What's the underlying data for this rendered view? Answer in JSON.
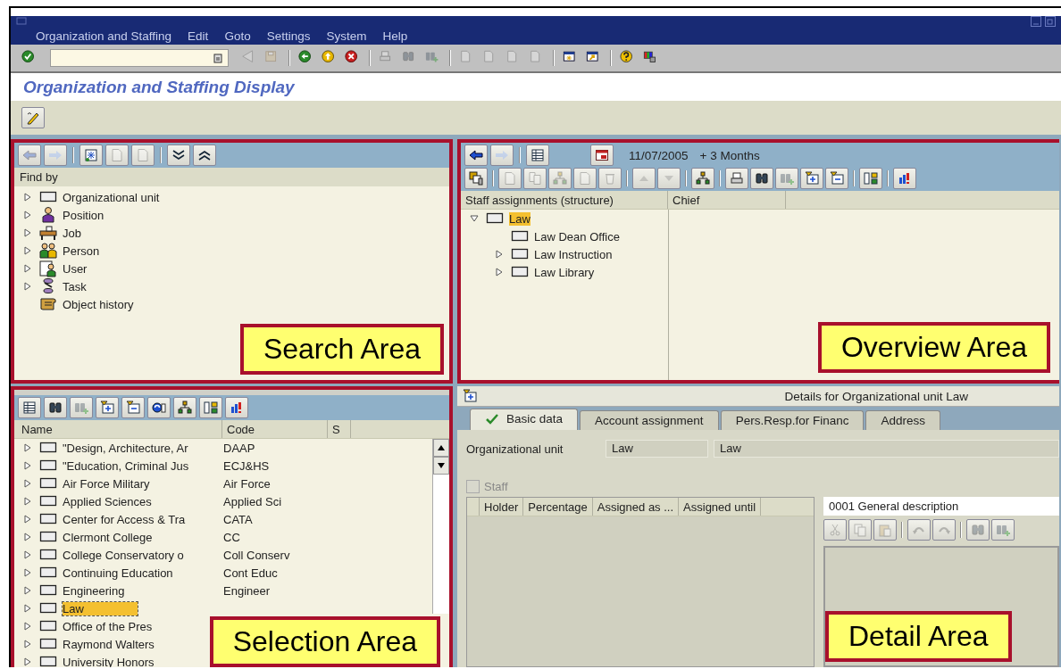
{
  "menu_bar": [
    "Organization and Staffing",
    "Edit",
    "Goto",
    "Settings",
    "System",
    "Help"
  ],
  "toolbar": {
    "buttons": [
      {
        "disabled": false
      },
      {
        "disabled": true
      },
      {
        "disabled": true
      },
      {
        "disabled": false
      },
      {
        "disabled": false
      },
      {
        "disabled": false
      },
      {
        "disabled": true
      },
      {
        "disabled": true
      },
      {
        "disabled": true
      },
      {
        "disabled": true
      },
      {
        "disabled": true
      },
      {
        "disabled": true
      },
      {
        "disabled": true
      },
      {
        "disabled": false
      },
      {
        "disabled": false
      },
      {
        "disabled": false
      },
      {
        "disabled": false
      }
    ]
  },
  "title": "Organization and Staffing Display",
  "search_area": {
    "callout": "Search Area",
    "toolbar": [
      {
        "disabled": true
      },
      {
        "disabled": true
      },
      {
        "disabled": false
      },
      {
        "disabled": true
      },
      {
        "disabled": true
      },
      {
        "disabled": false
      },
      {
        "disabled": false
      }
    ],
    "heading": "Find by",
    "items": [
      {
        "label": "Organizational unit",
        "kind": "org-unit",
        "expandable": true
      },
      {
        "label": "Position",
        "kind": "position",
        "expandable": true
      },
      {
        "label": "Job",
        "kind": "job",
        "expandable": true
      },
      {
        "label": "Person",
        "kind": "person",
        "expandable": true
      },
      {
        "label": "User",
        "kind": "user",
        "expandable": true
      },
      {
        "label": "Task",
        "kind": "task",
        "expandable": true
      },
      {
        "label": "Object history",
        "kind": "history",
        "expandable": false
      }
    ]
  },
  "overview_area": {
    "callout": "Overview Area",
    "toolbar_top": [
      {
        "disabled": false
      },
      {
        "disabled": true
      },
      {
        "disabled": false
      },
      {
        "disabled": false
      }
    ],
    "date": "11/07/2005",
    "period": "+ 3 Months",
    "toolbar": [
      {
        "disabled": false
      },
      {
        "disabled": true
      },
      {
        "disabled": true
      },
      {
        "disabled": true
      },
      {
        "disabled": true
      },
      {
        "disabled": true
      },
      {
        "disabled": true
      },
      {
        "disabled": true
      },
      {
        "disabled": false
      },
      {
        "disabled": false
      },
      {
        "disabled": false
      },
      {
        "disabled": true
      },
      {
        "disabled": false
      },
      {
        "disabled": false
      },
      {
        "disabled": false
      },
      {
        "disabled": false
      }
    ],
    "columns": [
      "Staff assignments (structure)",
      "Chief"
    ],
    "tree": [
      {
        "label": "Law",
        "selected": true,
        "expandable": true,
        "expanded": true,
        "children": [
          {
            "label": "Law Dean Office",
            "selected": false,
            "expandable": false
          },
          {
            "label": "Law Instruction",
            "selected": false,
            "expandable": true,
            "expanded": false
          },
          {
            "label": "Law Library",
            "selected": false,
            "expandable": true,
            "expanded": false
          }
        ]
      }
    ]
  },
  "selection_area": {
    "callout": "Selection Area",
    "toolbar": [
      {
        "disabled": false
      },
      {
        "disabled": false
      },
      {
        "disabled": true
      },
      {
        "disabled": false
      },
      {
        "disabled": false
      },
      {
        "disabled": false
      },
      {
        "disabled": false
      },
      {
        "disabled": false
      },
      {
        "disabled": false
      }
    ],
    "columns": [
      "Name",
      "Code",
      "S"
    ],
    "rows": [
      {
        "name": "\"Design, Architecture, Ar",
        "code": "DAAP",
        "selected": false
      },
      {
        "name": "\"Education, Criminal Jus",
        "code": "ECJ&HS",
        "selected": false
      },
      {
        "name": "Air Force Military",
        "code": "Air Force",
        "selected": false
      },
      {
        "name": "Applied Sciences",
        "code": "Applied Sci",
        "selected": false
      },
      {
        "name": "Center for Access & Tra",
        "code": "CATA",
        "selected": false
      },
      {
        "name": "Clermont College",
        "code": "CC",
        "selected": false
      },
      {
        "name": "College  Conservatory o",
        "code": "Coll Conserv",
        "selected": false
      },
      {
        "name": "Continuing Education",
        "code": "Cont Educ",
        "selected": false
      },
      {
        "name": "Engineering",
        "code": "Engineer",
        "selected": false
      },
      {
        "name": "Law",
        "selected": true
      },
      {
        "name": "Office of  the Pres",
        "selected": false
      },
      {
        "name": "Raymond Walters",
        "selected": false
      },
      {
        "name": "University Honors",
        "selected": false
      }
    ]
  },
  "detail_area": {
    "callout": "Detail Area",
    "header": "Details for Organizational unit Law",
    "tabs": [
      {
        "label": "Basic data",
        "selected": true
      },
      {
        "label": "Account assignment",
        "selected": false
      },
      {
        "label": "Pers.Resp.for Financ",
        "selected": false
      },
      {
        "label": "Address",
        "selected": false
      }
    ],
    "field_label": "Organizational unit",
    "field_values": [
      "Law",
      "Law"
    ],
    "staff": {
      "label": "Staff",
      "checked": false,
      "disabled": true
    },
    "table_columns": [
      "Holder",
      "Percentage",
      "Assigned as ...",
      "Assigned until"
    ],
    "description": "0001 General description",
    "description_toolbar": [
      {
        "disabled": true
      },
      {
        "disabled": true
      },
      {
        "disabled": true
      },
      {
        "disabled": true
      },
      {
        "disabled": true
      },
      {
        "disabled": true
      },
      {
        "disabled": true
      }
    ]
  }
}
